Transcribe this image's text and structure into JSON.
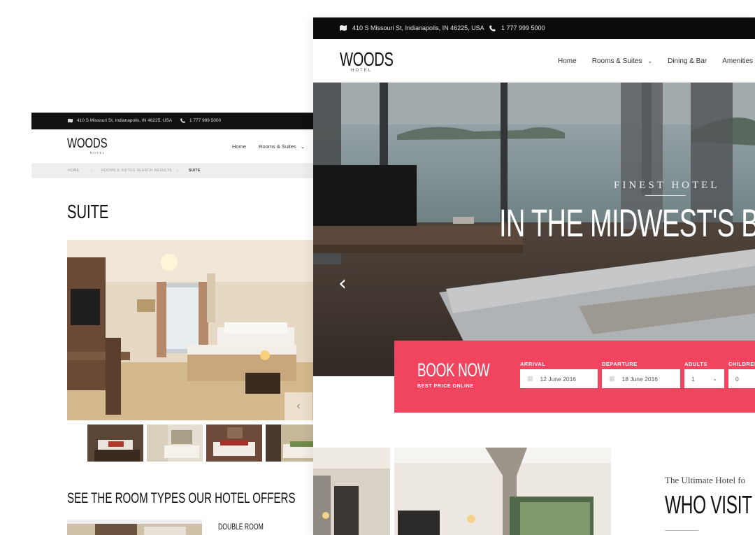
{
  "back_page": {
    "topbar": {
      "address": "410 S Missouri St, Indianapolis, IN 46225, USA",
      "phone": "1 777 999 5000",
      "address_icon": "map-icon",
      "phone_icon": "phone-icon"
    },
    "logo": {
      "word": "WOODS",
      "sub": "HOTEL"
    },
    "nav": {
      "home": "Home",
      "rooms": "Rooms & Suites"
    },
    "breadcrumb": {
      "home": "HOME",
      "sep": "›",
      "results": "ROOMS & SUITES SEARCH RESULTS",
      "current": "SUITE"
    },
    "title": "SUITE",
    "section_heading": "SEE THE ROOM TYPES OUR HOTEL OFFERS",
    "room_name": "DOUBLE ROOM",
    "arrow": "‹"
  },
  "front_page": {
    "topbar": {
      "address": "410 S Missouri St, Indianapolis, IN 46225, USA",
      "phone": "1 777 999 5000"
    },
    "logo": {
      "word": "WOODS",
      "sub": "HOTEL"
    },
    "nav": {
      "home": "Home",
      "rooms": "Rooms & Suites",
      "dining": "Dining & Bar",
      "amenities": "Amenities"
    },
    "hero": {
      "kicker": "FINEST HOTEL",
      "headline": "IN THE MIDWEST'S BES",
      "prev_arrow": "‹"
    },
    "booking": {
      "title": "BOOK NOW",
      "subtitle": "BEST PRICE ONLINE",
      "arrival_label": "ARRIVAL",
      "arrival_value": "12 June 2016",
      "departure_label": "DEPARTURE",
      "departure_value": "18 June 2016",
      "adults_label": "ADULTS",
      "adults_value": "1",
      "children_label": "CHILDREN",
      "children_value": "0",
      "accent_color": "#f1455f"
    },
    "intro": {
      "kicker": "The Ultimate Hotel fo",
      "heading": "WHO VISIT TH"
    }
  }
}
